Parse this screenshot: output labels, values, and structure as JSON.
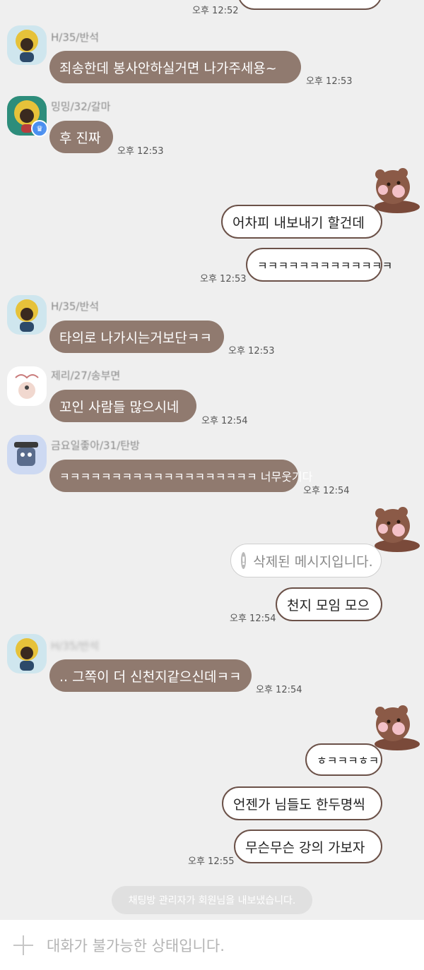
{
  "messages": {
    "m0": {
      "time": "오후 12:52"
    },
    "m1": {
      "sender": "H/35/반석",
      "text": "죄송한데 봉사안하실거면 나가주세용~",
      "time": "오후 12:53"
    },
    "m2": {
      "sender": "밍밍/32/갈마",
      "text": "후 진짜",
      "time": "오후 12:53"
    },
    "m3": {
      "text": "어차피 내보내기 할건데"
    },
    "m4": {
      "text": "ㅋㅋㅋㅋㅋㅋㅋㅋㅋㅋㅋㅋㅋ",
      "time": "오후 12:53"
    },
    "m5": {
      "sender": "H/35/반석",
      "text": "타의로 나가시는거보단ㅋㅋ",
      "time": "오후 12:53"
    },
    "m6": {
      "sender": "제리/27/송부면",
      "text": "꼬인 사람들 많으시네",
      "time": "오후 12:54"
    },
    "m7": {
      "sender": "금요일좋아/31/탄방",
      "text": "ㅋㅋㅋㅋㅋㅋㅋㅋㅋㅋㅋㅋㅋㅋㅋㅋㅋㅋㅋ 너무웃기다",
      "time": "오후 12:54"
    },
    "m8": {
      "text": "삭제된 메시지입니다."
    },
    "m9": {
      "text": "천지 모임 모으",
      "time": "오후 12:54"
    },
    "m10": {
      "sender": "H/35/반석",
      "text": ".. 그쪽이 더 신천지같으신데ㅋㅋ",
      "time": "오후 12:54"
    },
    "m11": {
      "text": "ㅎㅋㅋㅋㅎㅋ"
    },
    "m12": {
      "text": "언젠가 님들도 한두명씩"
    },
    "m13": {
      "text": "무슨무슨 강의 가보자",
      "time": "오후 12:55"
    }
  },
  "system_notice": "채팅방 관리자가 회원님을 내보냈습니다.",
  "input_bar": {
    "placeholder": "대화가 불가능한 상태입니다.",
    "plus_icon": "plus-icon"
  },
  "colors": {
    "incoming_bubble": "#8a7266",
    "outgoing_border": "#6b5148",
    "background": "#efefef"
  }
}
